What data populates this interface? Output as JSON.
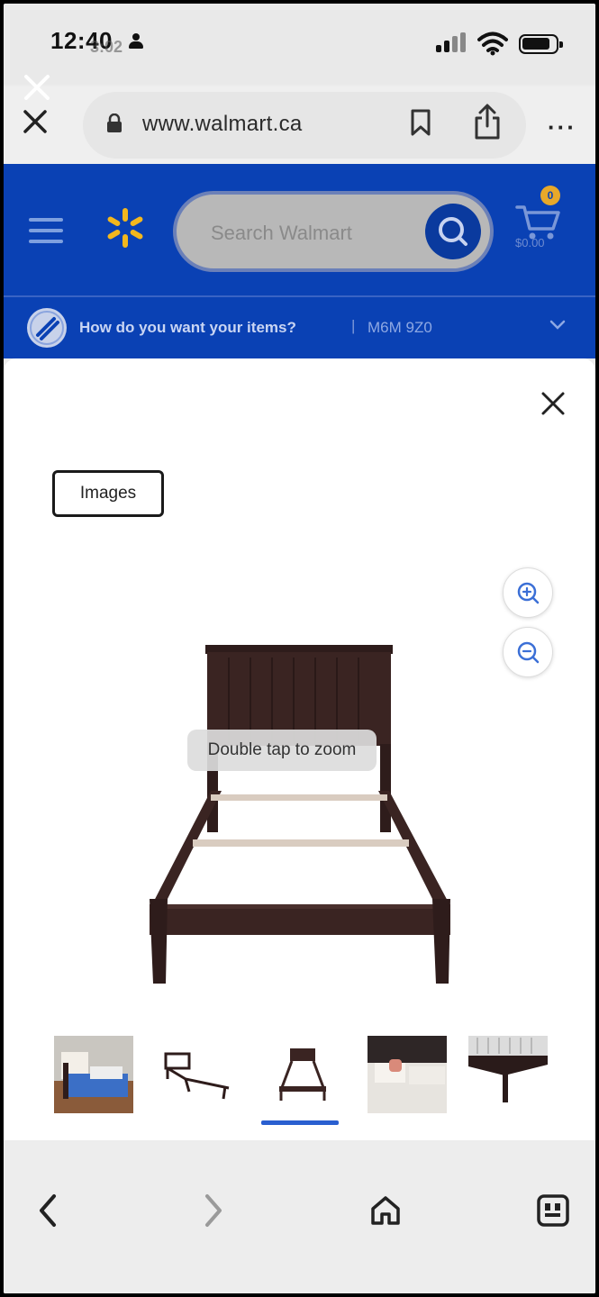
{
  "status_bar": {
    "time": "12:40",
    "time_ghost": "3:02"
  },
  "browser": {
    "url": "www.walmart.ca",
    "more_label": "···"
  },
  "walmart": {
    "search_placeholder": "Search Walmart",
    "cart_label": "$0.00",
    "cart_count": "0",
    "delivery_prompt": "How do you want your items?",
    "delivery_separator": "|",
    "postal_code": "M6M 9Z0"
  },
  "viewer": {
    "images_tab": "Images",
    "tooltip": "Double tap to zoom",
    "selected_thumbnail_index": 2,
    "thumbnails": [
      "bedroom-scene",
      "frame-side",
      "frame-front",
      "bed-with-pillows",
      "mattress-corner"
    ]
  },
  "colors": {
    "walmart_blue": "#0a41b4",
    "spark_yellow": "#f3b71d",
    "frame_brown": "#3a2422",
    "selected_underline": "#2a5fd0"
  }
}
